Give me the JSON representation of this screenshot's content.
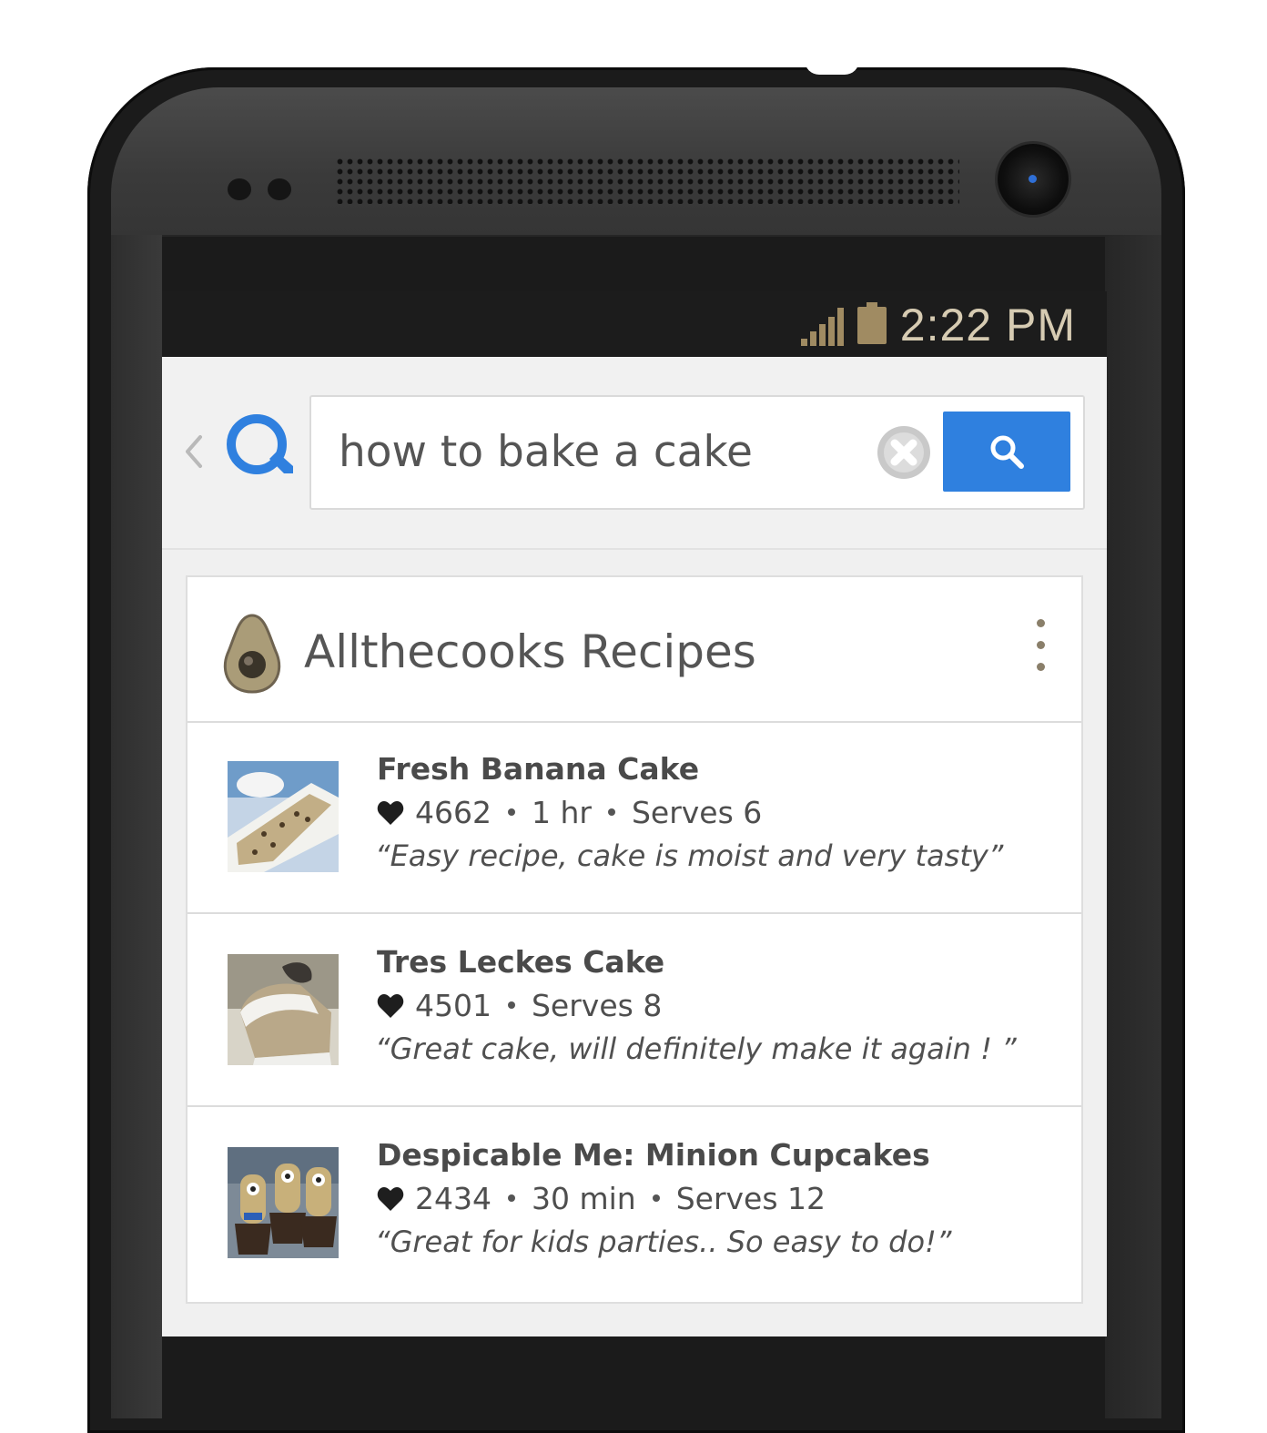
{
  "status_bar": {
    "time": "2:22 PM",
    "icons": [
      "signal-icon",
      "battery-icon"
    ]
  },
  "search": {
    "query": "how to bake a cake",
    "icons": [
      "back-icon",
      "app-logo-icon",
      "clear-icon",
      "search-icon"
    ]
  },
  "source": {
    "title": "Allthecooks Recipes",
    "icon": "avocado-logo-icon"
  },
  "recipes": [
    {
      "title": "Fresh Banana Cake",
      "likes": "4662",
      "time": "1 hr",
      "serves": "Serves 6",
      "quote": "“Easy recipe, cake is moist and very tasty”"
    },
    {
      "title": "Tres Leckes Cake",
      "likes": "4501",
      "serves": "Serves 8",
      "quote": "“Great cake, will definitely make it again ! ”"
    },
    {
      "title": "Despicable Me: Minion Cupcakes",
      "likes": "2434",
      "time": "30 min",
      "serves": "Serves 12",
      "quote": "“Great for kids parties.. So easy to do!”"
    }
  ],
  "colors": {
    "accent": "#2f80df",
    "status_bar": "#1c1c1c",
    "brand_olive": "#8a7f6a"
  }
}
